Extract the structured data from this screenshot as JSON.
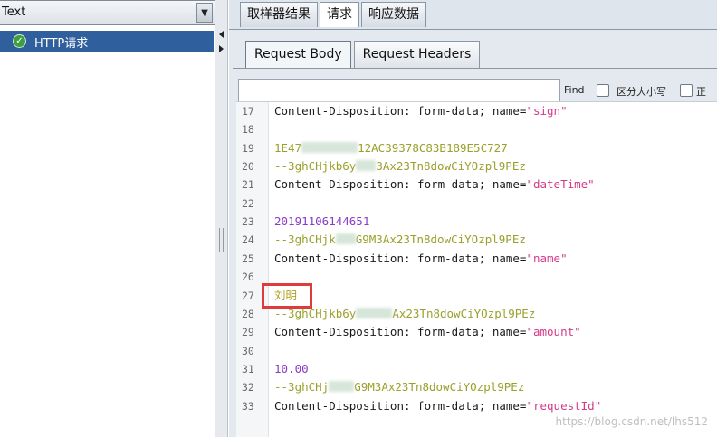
{
  "left": {
    "combo_value": "Text",
    "combo_arrow": "▼",
    "tree_item_label": "HTTP请求"
  },
  "top_tabs": [
    {
      "label": "取样器结果"
    },
    {
      "label": "请求"
    },
    {
      "label": "响应数据"
    }
  ],
  "sub_tabs": [
    {
      "label": "Request Body"
    },
    {
      "label": "Request Headers"
    }
  ],
  "search": {
    "placeholder": "",
    "find_label": "Find",
    "case_label": "区分大小写",
    "regex_label": "正"
  },
  "code_lines": [
    {
      "n": "17",
      "key": "Content-Disposition: form-data; name=",
      "val": "\"sign\""
    },
    {
      "n": "18"
    },
    {
      "n": "19",
      "hash_a": "1E47",
      "hash_b": "12AC39378C83B189E5C727"
    },
    {
      "n": "20",
      "b_a": "--3ghCHjkb6y",
      "b_b": "3Ax23Tn8dowCiYOzpl9PEz"
    },
    {
      "n": "21",
      "key": "Content-Disposition: form-data; name=",
      "val": "\"dateTime\""
    },
    {
      "n": "22"
    },
    {
      "n": "23",
      "num": "20191106144651"
    },
    {
      "n": "24",
      "b_a": "--3ghCHjk",
      "b_b": "G9M3Ax23Tn8dowCiYOzpl9PEz"
    },
    {
      "n": "25",
      "key": "Content-Disposition: form-data; name=",
      "val": "\"name\""
    },
    {
      "n": "26"
    },
    {
      "n": "27",
      "cjk": "刘明"
    },
    {
      "n": "28",
      "b_a": "--3ghCHjkb6y",
      "b_b": "Ax23Tn8dowCiYOzpl9PEz"
    },
    {
      "n": "29",
      "key": "Content-Disposition: form-data; name=",
      "val": "\"amount\""
    },
    {
      "n": "30"
    },
    {
      "n": "31",
      "num": "10.00"
    },
    {
      "n": "32",
      "b_a": "--3ghCHj",
      "b_b": "G9M3Ax23Tn8dowCiYOzpl9PEz"
    },
    {
      "n": "33",
      "key": "Content-Disposition: form-data; name=",
      "val": "\"requestId\""
    }
  ],
  "watermark": "https://blog.csdn.net/lhs512",
  "icons": {
    "tree": "http-sampler-icon",
    "combo": "dropdown-arrow-icon",
    "collapse_left": "collapse-left-icon",
    "collapse_right": "collapse-right-icon"
  }
}
